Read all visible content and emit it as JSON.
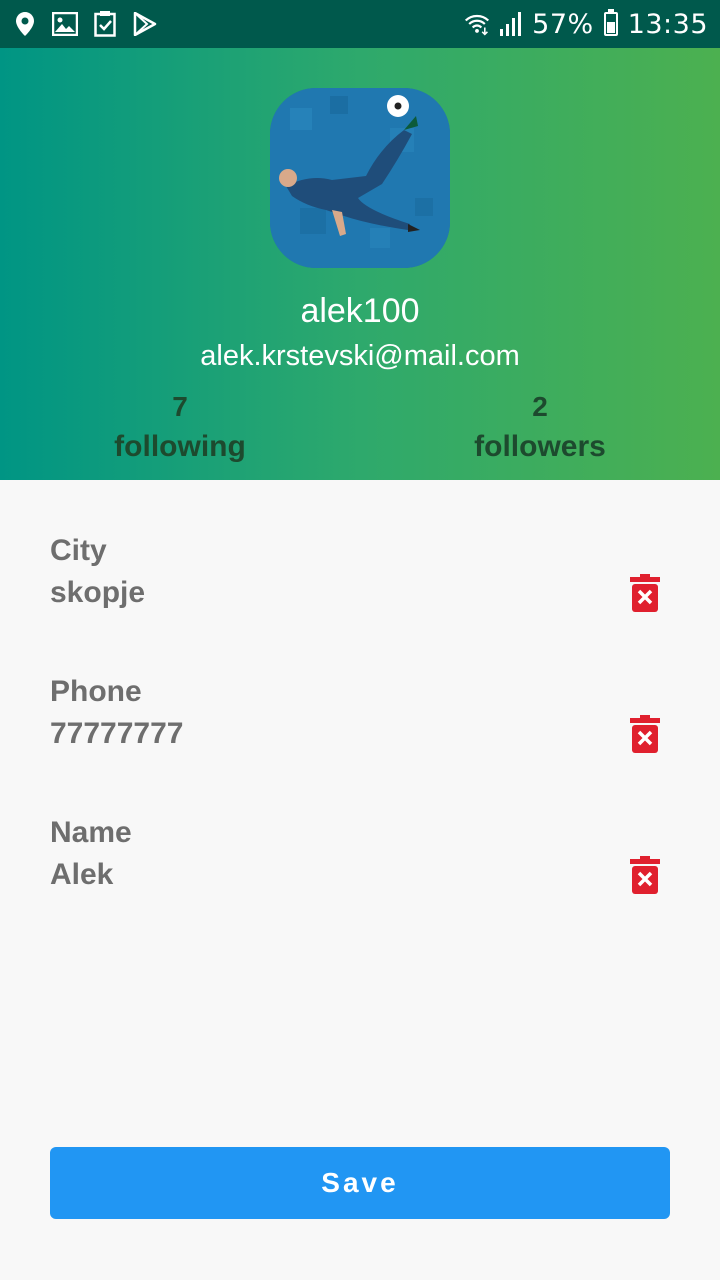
{
  "status_bar": {
    "icons_left": [
      "location-icon",
      "image-icon",
      "task-check-icon",
      "play-store-icon"
    ],
    "battery_text": "57%",
    "battery_level": 0.57,
    "time": "13:35"
  },
  "profile": {
    "username": "alek100",
    "email": "alek.krstevski@mail.com",
    "stats": {
      "following_count": "7",
      "following_label": "following",
      "followers_count": "2",
      "followers_label": "followers"
    }
  },
  "fields": [
    {
      "label": "City",
      "value": "skopje"
    },
    {
      "label": "Phone",
      "value": "77777777"
    },
    {
      "label": "Name",
      "value": "Alek"
    }
  ],
  "save_label": "Save",
  "colors": {
    "status_bar": "#00594c",
    "header_gradient_start": "#009584",
    "header_gradient_end": "#4cb050",
    "delete_icon": "#e0202e",
    "save_button": "#2196f3",
    "field_text": "#6e6e6e"
  }
}
